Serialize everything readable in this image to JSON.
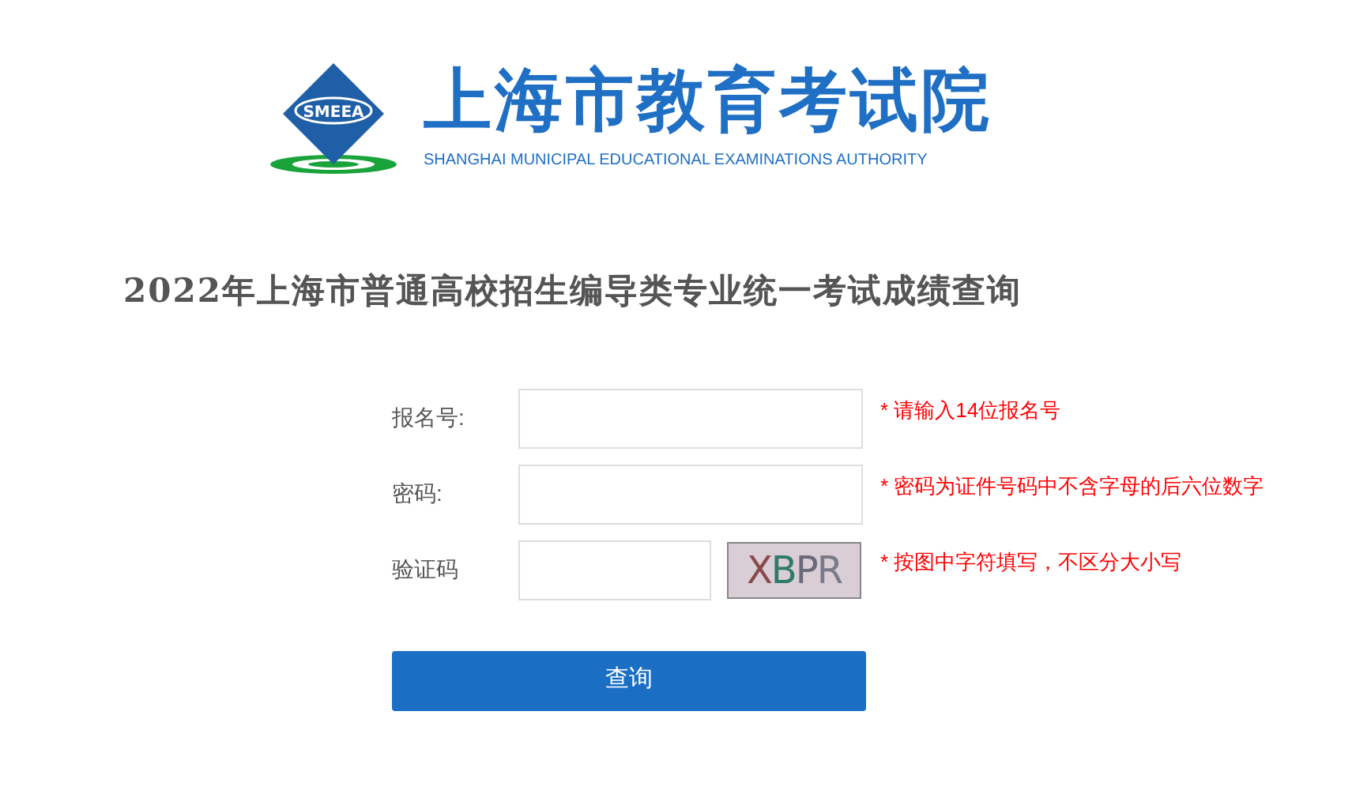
{
  "header": {
    "logo_text": "SMEEA",
    "title": "上海市教育考试院",
    "subtitle": "SHANGHAI MUNICIPAL EDUCATIONAL EXAMINATIONS AUTHORITY"
  },
  "page_title": "2022年上海市普通高校招生编导类专业统一考试成绩查询",
  "form": {
    "fields": [
      {
        "kind": "text",
        "label": "报名号:",
        "hint": "* 请输入14位报名号"
      },
      {
        "kind": "text",
        "label": "密码:",
        "hint": "* 密码为证件号码中不含字母的后六位数字"
      },
      {
        "kind": "captcha",
        "label": "验证码",
        "captcha_text": "XBPR",
        "hint": "* 按图中字符填写，不区分大小写"
      }
    ],
    "submit": "查询"
  }
}
